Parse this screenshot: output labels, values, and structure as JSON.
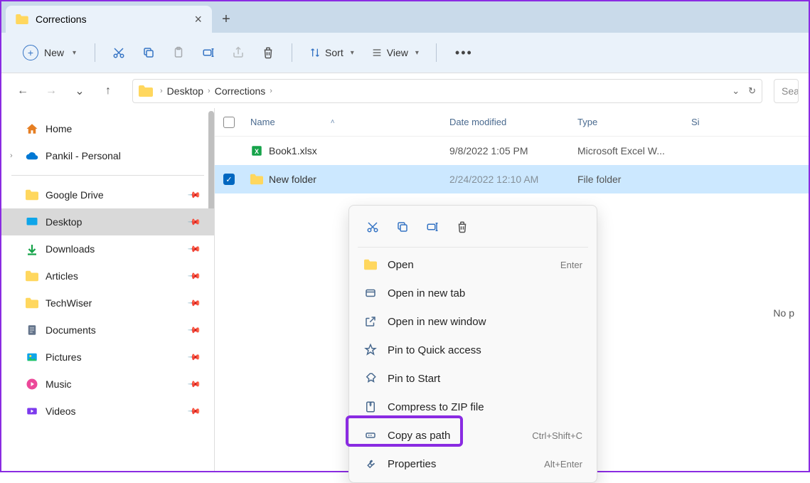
{
  "tab": {
    "title": "Corrections"
  },
  "toolbar": {
    "new_label": "New",
    "sort_label": "Sort",
    "view_label": "View"
  },
  "breadcrumb": {
    "parts": [
      "Desktop",
      "Corrections"
    ]
  },
  "search": {
    "placeholder": "Sear"
  },
  "sidebar": {
    "home": "Home",
    "cloud": "Pankil - Personal",
    "items": [
      "Google Drive",
      "Desktop",
      "Downloads",
      "Articles",
      "TechWiser",
      "Documents",
      "Pictures",
      "Music",
      "Videos"
    ]
  },
  "columns": {
    "name": "Name",
    "date": "Date modified",
    "type": "Type",
    "size": "Si"
  },
  "files": [
    {
      "name": "Book1.xlsx",
      "date": "9/8/2022 1:05 PM",
      "type": "Microsoft Excel W...",
      "icon": "excel"
    },
    {
      "name": "New folder",
      "date": "2/24/2022 12:10 AM",
      "type": "File folder",
      "icon": "folder",
      "selected": true
    }
  ],
  "empty": "No p",
  "context": {
    "open": "Open",
    "open_sc": "Enter",
    "open_tab": "Open in new tab",
    "open_window": "Open in new window",
    "pin_quick": "Pin to Quick access",
    "pin_start": "Pin to Start",
    "compress": "Compress to ZIP file",
    "copy_path": "Copy as path",
    "copy_path_sc": "Ctrl+Shift+C",
    "properties": "Properties",
    "properties_sc": "Alt+Enter"
  }
}
